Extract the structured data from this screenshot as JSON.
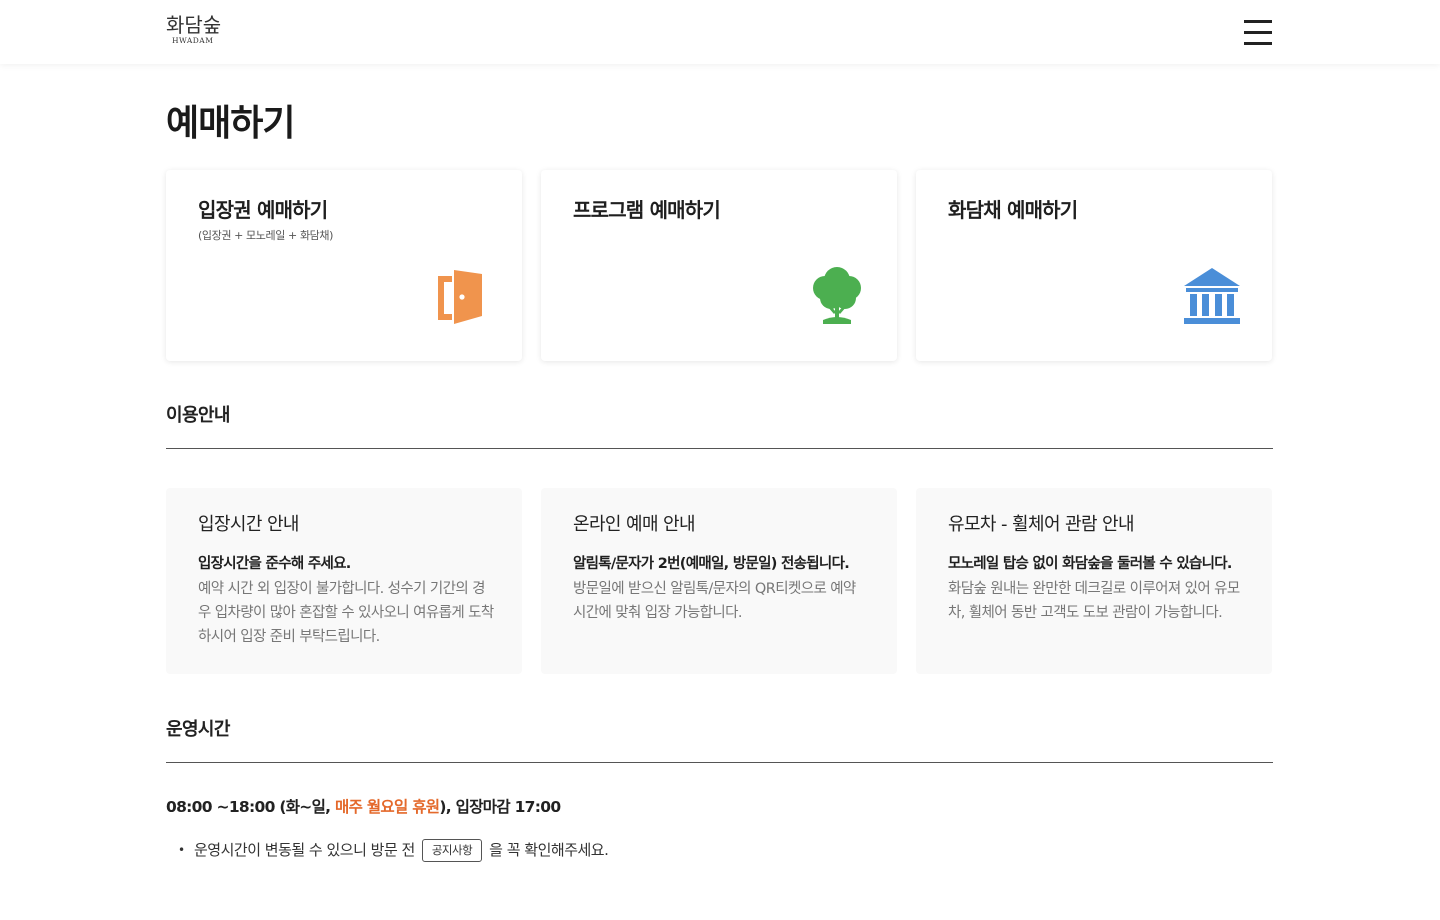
{
  "header": {
    "logo_ko": "화담숲",
    "logo_en": "HWADAM"
  },
  "page": {
    "title": "예매하기"
  },
  "booking_cards": [
    {
      "title": "입장권 예매하기",
      "subtitle": "(입장권 + 모노레일 + 화담채)",
      "icon": "door-icon",
      "icon_color": "#f0944d"
    },
    {
      "title": "프로그램 예매하기",
      "subtitle": "",
      "icon": "tree-icon",
      "icon_color": "#4caf50"
    },
    {
      "title": "화담채 예매하기",
      "subtitle": "",
      "icon": "museum-icon",
      "icon_color": "#4a8ed8"
    }
  ],
  "usage_guide": {
    "title": "이용안내",
    "cards": [
      {
        "title": "입장시간 안내",
        "bold": "입장시간을 준수해 주세요.",
        "body": "예약 시간 외 입장이 불가합니다. 성수기 기간의 경우 입차량이 많아 혼잡할 수 있사오니 여유롭게 도착하시어 입장 준비 부탁드립니다."
      },
      {
        "title": "온라인 예매 안내",
        "bold": "알림톡/문자가 2번(예매일, 방문일) 전송됩니다.",
        "body": "방문일에 받으신 알림톡/문자의 QR티켓으로 예약 시간에 맞춰 입장 가능합니다."
      },
      {
        "title": "유모차 - 휠체어 관람 안내",
        "bold": "모노레일 탑승 없이 화담숲을 둘러볼 수 있습니다.",
        "body": "화담숲 원내는 완만한 데크길로 이루어져 있어 유모차, 휠체어 동반 고객도 도보 관람이 가능합니다."
      }
    ]
  },
  "operating_hours": {
    "title": "운영시간",
    "hours_prefix": "08:00 ~18:00 (화~일, ",
    "hours_highlight": "매주 월요일 휴원",
    "hours_suffix": "), 입장마감 17:00",
    "highlight_color": "#e4692b",
    "notice_before": "운영시간이 변동될 수 있으니 방문 전",
    "notice_tag": "공지사항",
    "notice_after": "을 꼭 확인해주세요."
  }
}
